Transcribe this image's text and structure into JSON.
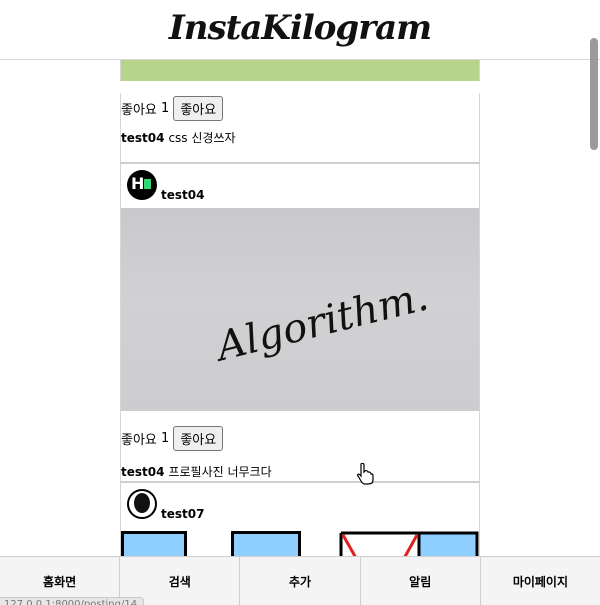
{
  "app": {
    "logo_text": "InstaKilogram"
  },
  "previous_post": {
    "media_color": "#b7d48a",
    "like_label": "좋아요",
    "like_count": "1",
    "like_button_label": "좋아요",
    "caption_user": "test04",
    "caption_text": "css 신경쓰자"
  },
  "post1": {
    "username": "test04",
    "avatar_icon": "hashnode-logo-icon",
    "photo_text": "Algorithm.",
    "like_label": "좋아요",
    "like_count": "1",
    "like_button_label": "좋아요",
    "caption_user": "test04",
    "caption_text": "프로필사진 너무크다"
  },
  "post2": {
    "username": "test07",
    "avatar_icon": "user-silhouette-icon"
  },
  "bottom_nav": {
    "items": [
      {
        "label": "홈화면"
      },
      {
        "label": "검색"
      },
      {
        "label": "추가"
      },
      {
        "label": "알림"
      },
      {
        "label": "마이페이지"
      }
    ]
  },
  "status_bar": {
    "url": "127.0.0.1:8000/posting/14"
  },
  "colors": {
    "accent_green": "#b7d48a",
    "tile_blue": "#8fcfff"
  }
}
